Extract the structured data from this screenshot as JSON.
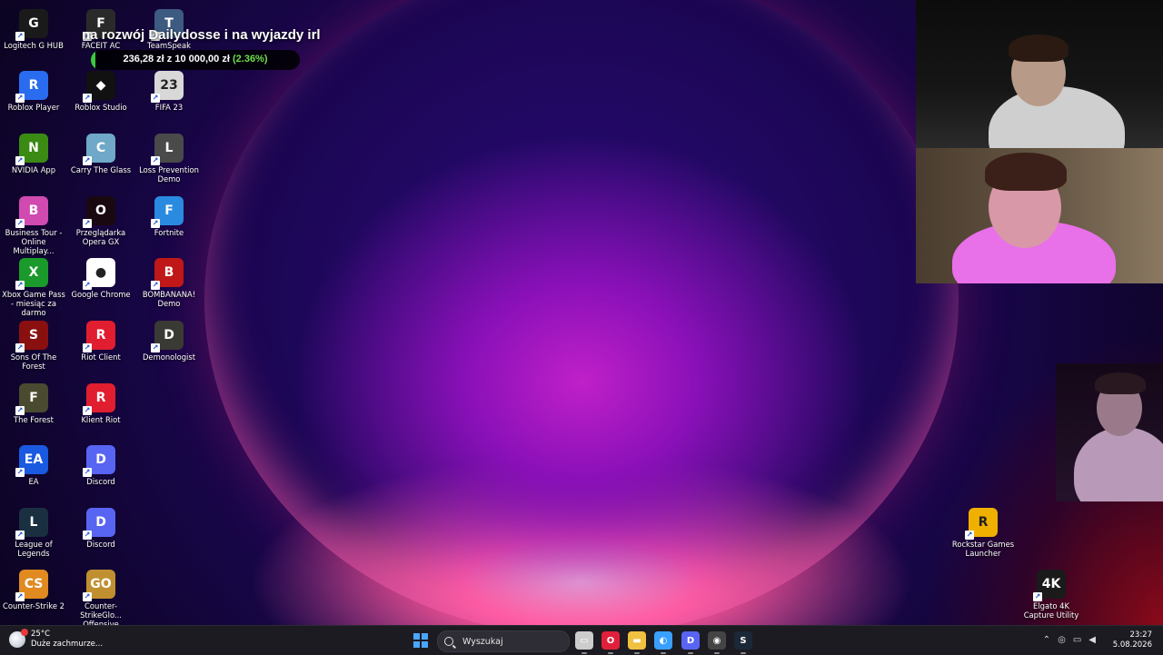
{
  "overlay": {
    "title": "na rozwój Dailydosse i na wyjazdy irl",
    "raised": "236,28 zł",
    "separator": "z",
    "goal": "10 000,00 zł",
    "percent_text": "(2.36%)",
    "progress_fraction": 0.0236
  },
  "desktop_icons": [
    {
      "label": "Logitech G HUB",
      "icon": "logitech-g-icon",
      "color": "#1a1a1a",
      "glyph": "G"
    },
    {
      "label": "FACEIT AC",
      "icon": "faceit-icon",
      "color": "#2a2a2a",
      "glyph": "F"
    },
    {
      "label": "TeamSpeak",
      "icon": "teamspeak-icon",
      "color": "#3d5a80",
      "glyph": "T"
    },
    {
      "label": "Roblox Player",
      "icon": "roblox-player-icon",
      "color": "#2a6cf0",
      "glyph": "R"
    },
    {
      "label": "Roblox Studio",
      "icon": "roblox-studio-icon",
      "color": "#111111",
      "glyph": "◆"
    },
    {
      "label": "FIFA 23",
      "icon": "fifa-icon",
      "color": "#d8d8d8",
      "glyph": "23"
    },
    {
      "label": "NVIDIA App",
      "icon": "nvidia-icon",
      "color": "#3a8a14",
      "glyph": "N"
    },
    {
      "label": "Carry The Glass",
      "icon": "carry-the-glass-icon",
      "color": "#6fa8c8",
      "glyph": "C"
    },
    {
      "label": "Loss Prevention Demo",
      "icon": "loss-prevention-icon",
      "color": "#4a4a4a",
      "glyph": "L"
    },
    {
      "label": "Business Tour - Online Multiplay...",
      "icon": "business-tour-icon",
      "color": "#d04ab0",
      "glyph": "B"
    },
    {
      "label": "Przeglądarka Opera GX",
      "icon": "opera-gx-icon",
      "color": "#1a0810",
      "glyph": "O"
    },
    {
      "label": "Fortnite",
      "icon": "fortnite-icon",
      "color": "#2a8ae0",
      "glyph": "F"
    },
    {
      "label": "Xbox Game Pass - miesiąc za darmo",
      "icon": "xbox-icon",
      "color": "#1a9a2a",
      "glyph": "X"
    },
    {
      "label": "Google Chrome",
      "icon": "chrome-icon",
      "color": "#ffffff",
      "glyph": "●"
    },
    {
      "label": "BOMBANANA! Demo",
      "icon": "bombanana-icon",
      "color": "#c01818",
      "glyph": "B"
    },
    {
      "label": "Sons Of The Forest",
      "icon": "sons-of-the-forest-icon",
      "color": "#8a1010",
      "glyph": "S"
    },
    {
      "label": "Riot Client",
      "icon": "riot-client-icon",
      "color": "#e01e30",
      "glyph": "R"
    },
    {
      "label": "Demonologist",
      "icon": "demonologist-icon",
      "color": "#3a3a34",
      "glyph": "D"
    },
    {
      "label": "The Forest",
      "icon": "the-forest-icon",
      "color": "#4a4a30",
      "glyph": "F"
    },
    {
      "label": "Klient Riot",
      "icon": "klient-riot-icon",
      "color": "#e01e30",
      "glyph": "R"
    },
    {
      "label": "EA",
      "icon": "ea-icon",
      "color": "#1a5ae0",
      "glyph": "EA"
    },
    {
      "label": "Discord",
      "icon": "discord-icon",
      "color": "#5865f2",
      "glyph": "D"
    },
    {
      "label": "League of Legends",
      "icon": "league-of-legends-icon",
      "color": "#1a3040",
      "glyph": "L"
    },
    {
      "label": "Discord",
      "icon": "discord-icon",
      "color": "#5865f2",
      "glyph": "D"
    },
    {
      "label": "Counter-Strike 2",
      "icon": "cs2-icon",
      "color": "#e08a20",
      "glyph": "CS"
    },
    {
      "label": "Counter-StrikeGlo... Offensive",
      "icon": "csgo-icon",
      "color": "#c09030",
      "glyph": "GO"
    },
    {
      "label": "Rockstar Games Launcher",
      "icon": "rockstar-icon",
      "color": "#f0b000",
      "glyph": "R"
    },
    {
      "label": "Elgato 4K Capture Utility",
      "icon": "elgato-4k-icon",
      "color": "#1a1a1a",
      "glyph": "4K"
    }
  ],
  "taskbar": {
    "weather_temp": "25°C",
    "weather_desc": "Duże zachmurze...",
    "search_placeholder": "Wyszukaj",
    "apps": [
      {
        "name": "task-view",
        "icon": "task-view-icon",
        "color": "#cccccc",
        "glyph": "▭"
      },
      {
        "name": "opera-gx",
        "icon": "opera-gx-icon",
        "color": "#e0203a",
        "glyph": "O"
      },
      {
        "name": "file-explorer",
        "icon": "folder-icon",
        "color": "#f0c040",
        "glyph": "▬"
      },
      {
        "name": "copilot",
        "icon": "copilot-icon",
        "color": "#3aa0ff",
        "glyph": "◐"
      },
      {
        "name": "discord",
        "icon": "discord-icon",
        "color": "#5865f2",
        "glyph": "D"
      },
      {
        "name": "obs",
        "icon": "obs-icon",
        "color": "#444444",
        "glyph": "◉"
      },
      {
        "name": "steam",
        "icon": "steam-icon",
        "color": "#1b2838",
        "glyph": "S"
      }
    ],
    "time": "23:27",
    "date": "5.08.2026"
  }
}
